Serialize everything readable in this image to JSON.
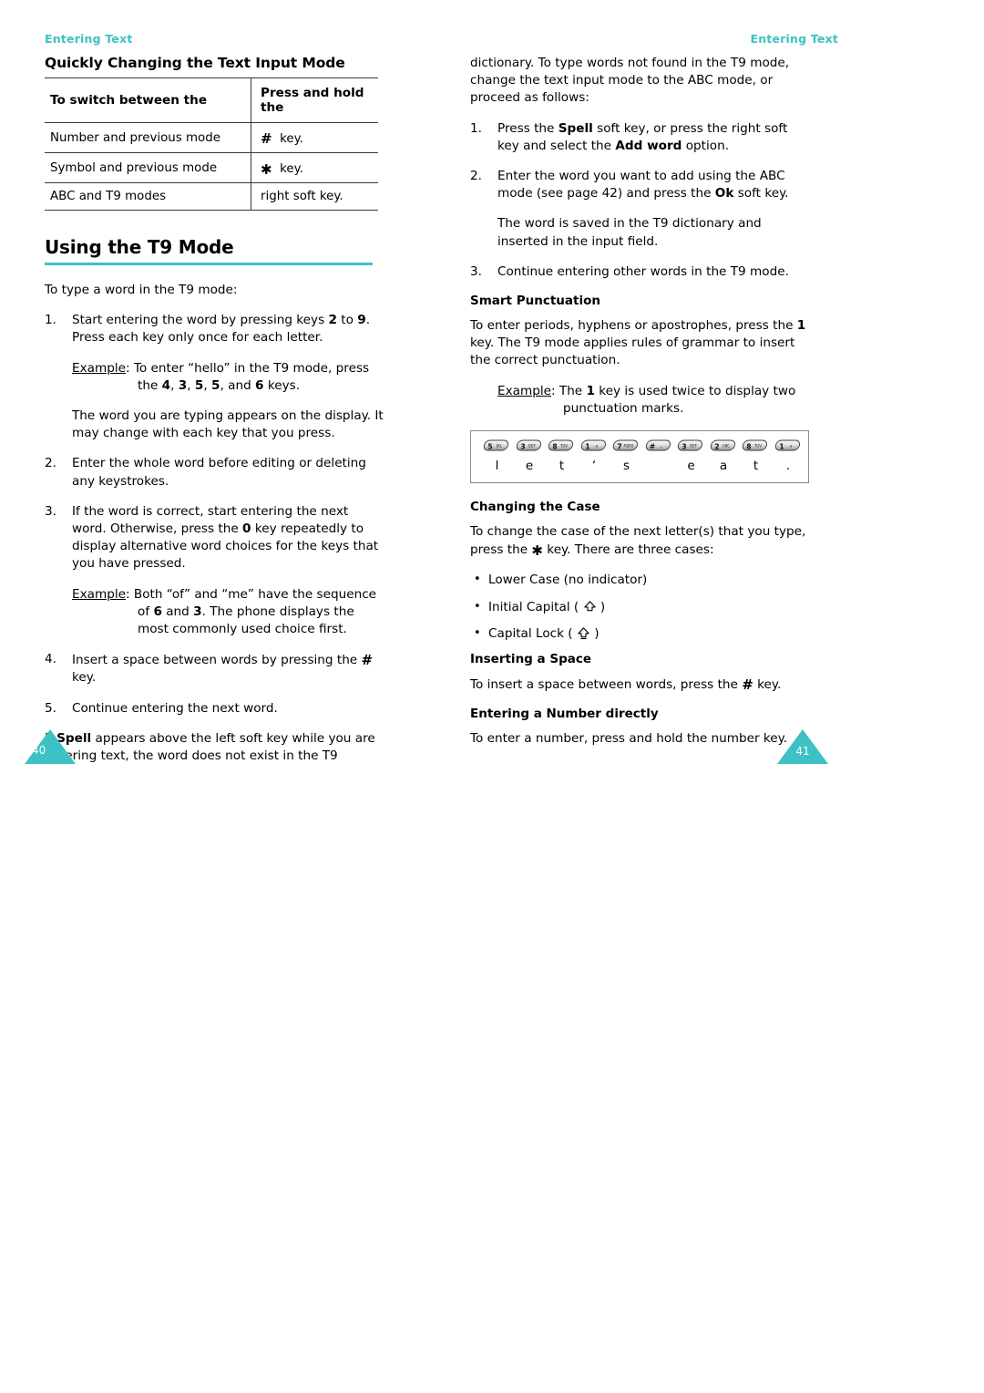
{
  "running_head": {
    "left": "Entering Text",
    "right": "Entering Text"
  },
  "colors": {
    "accent_teal": "#3ec1c5",
    "body_text": "#000000",
    "rule": "#3a3a3a"
  },
  "left_column": {
    "section_heading": "Quickly Changing the Text Input Mode",
    "table": {
      "headers": [
        "To switch between the",
        "Press and hold the"
      ],
      "rows": [
        {
          "mode": "Number and previous mode",
          "key_glyph": "#",
          "key_text": "key."
        },
        {
          "mode": "Symbol and previous mode",
          "key_glyph": "✱",
          "key_text": "key."
        },
        {
          "mode": "ABC and T9 modes",
          "key_glyph": "",
          "key_text": "right soft key."
        }
      ]
    },
    "chapter_heading": "Using the T9 Mode",
    "intro": "To type a word in the T9 mode:",
    "steps": [
      {
        "num": "1.",
        "text_parts": [
          {
            "t": "Start entering the word by pressing keys "
          },
          {
            "t": "2",
            "b": true
          },
          {
            "t": " to "
          },
          {
            "t": "9",
            "b": true
          },
          {
            "t": ". Press each key only once for each letter."
          }
        ],
        "example": {
          "label": "Example",
          "parts": [
            {
              "t": ": To enter “hello” in the T9 mode, press the "
            },
            {
              "t": "4",
              "b": true
            },
            {
              "t": ", "
            },
            {
              "t": "3",
              "b": true
            },
            {
              "t": ", "
            },
            {
              "t": "5",
              "b": true
            },
            {
              "t": ", "
            },
            {
              "t": "5",
              "b": true
            },
            {
              "t": ", and "
            },
            {
              "t": "6",
              "b": true
            },
            {
              "t": " keys."
            }
          ]
        },
        "follow_up": "The word you are typing appears on the display. It may change with each key that you press."
      },
      {
        "num": "2.",
        "text_parts": [
          {
            "t": "Enter the whole word before editing or deleting any keystrokes."
          }
        ]
      },
      {
        "num": "3.",
        "text_parts": [
          {
            "t": "If the word is correct, start entering the next word. Otherwise, press the "
          },
          {
            "t": "0",
            "b": true
          },
          {
            "t": " key repeatedly to display alternative word choices for the keys that you have pressed."
          }
        ],
        "example": {
          "label": "Example",
          "parts": [
            {
              "t": ": Both “of” and “me” have the sequence of "
            },
            {
              "t": "6",
              "b": true
            },
            {
              "t": " and "
            },
            {
              "t": "3",
              "b": true
            },
            {
              "t": ". The phone displays the most commonly used choice first."
            }
          ]
        }
      },
      {
        "num": "4.",
        "text_parts": [
          {
            "t": "Insert a space between words by pressing the "
          },
          {
            "t": "#",
            "glyph": "hash"
          },
          {
            "t": " key."
          }
        ]
      },
      {
        "num": "5.",
        "text_parts": [
          {
            "t": "Continue entering the next word."
          }
        ]
      }
    ],
    "closing_parts": [
      {
        "t": "If "
      },
      {
        "t": "Spell",
        "b": true
      },
      {
        "t": " appears above the left soft key while you are entering text, the word does not exist in the T9"
      }
    ],
    "page_number": "40"
  },
  "right_column": {
    "continuation_parts": [
      {
        "t": "dictionary. To type words not found in the T9 mode, change the text input mode to the ABC mode, or proceed as follows:"
      }
    ],
    "steps": [
      {
        "num": "1.",
        "text_parts": [
          {
            "t": "Press the "
          },
          {
            "t": "Spell",
            "b": true
          },
          {
            "t": " soft key, or press the right soft key and select the "
          },
          {
            "t": "Add word",
            "b": true
          },
          {
            "t": " option."
          }
        ]
      },
      {
        "num": "2.",
        "text_parts": [
          {
            "t": "Enter the word you want to add using the ABC mode (see page 42) and press the "
          },
          {
            "t": "Ok",
            "b": true
          },
          {
            "t": " soft key."
          }
        ],
        "follow_up": "The word is saved in the T9 dictionary and inserted in the input field."
      },
      {
        "num": "3.",
        "text_parts": [
          {
            "t": "Continue entering other words in the T9 mode."
          }
        ]
      }
    ],
    "smart_punctuation": {
      "heading": "Smart Punctuation",
      "body_parts": [
        {
          "t": "To enter periods, hyphens or apostrophes, press the "
        },
        {
          "t": "1",
          "b": true
        },
        {
          "t": " key. The T9 mode applies rules of grammar to insert the correct punctuation."
        }
      ],
      "example": {
        "label": "Example",
        "parts": [
          {
            "t": ": The "
          },
          {
            "t": "1",
            "b": true
          },
          {
            "t": " key is used twice to display two punctuation marks."
          }
        ]
      },
      "figure": {
        "keys": [
          {
            "digit": "5",
            "letters": "JKL",
            "char": "l"
          },
          {
            "digit": "3",
            "letters": "DEF",
            "char": "e"
          },
          {
            "digit": "8",
            "letters": "TUV",
            "char": "t"
          },
          {
            "digit": "1",
            "letters": "⌀",
            "char": "‘"
          },
          {
            "digit": "7",
            "letters": "PQRS",
            "char": "s"
          },
          {
            "digit": "#",
            "letters": "␣",
            "char": ""
          },
          {
            "digit": "3",
            "letters": "DEF",
            "char": "e"
          },
          {
            "digit": "2",
            "letters": "ABC",
            "char": "a"
          },
          {
            "digit": "8",
            "letters": "TUV",
            "char": "t"
          },
          {
            "digit": "1",
            "letters": "⌀",
            "char": "."
          }
        ],
        "result_text": "let's eat."
      }
    },
    "changing_case": {
      "heading": "Changing the Case",
      "body_parts": [
        {
          "t": "To change the case of the next letter(s) that you type, press the "
        },
        {
          "t": "✱",
          "glyph": "star"
        },
        {
          "t": " key. There are three cases:"
        }
      ],
      "cases": [
        {
          "label": "Lower Case (no indicator)",
          "icon": "none"
        },
        {
          "label_before": "Initial Capital (",
          "icon": "shift-outline",
          "label_after": ")"
        },
        {
          "label_before": "Capital Lock (",
          "icon": "shift-lock",
          "label_after": ")"
        }
      ]
    },
    "inserting_space": {
      "heading": "Inserting a Space",
      "body_parts": [
        {
          "t": "To insert a space between words, press the "
        },
        {
          "t": "#",
          "glyph": "hash"
        },
        {
          "t": " key."
        }
      ]
    },
    "entering_number": {
      "heading": "Entering a Number directly",
      "body": "To enter a number, press and hold the number key."
    },
    "page_number": "41"
  }
}
